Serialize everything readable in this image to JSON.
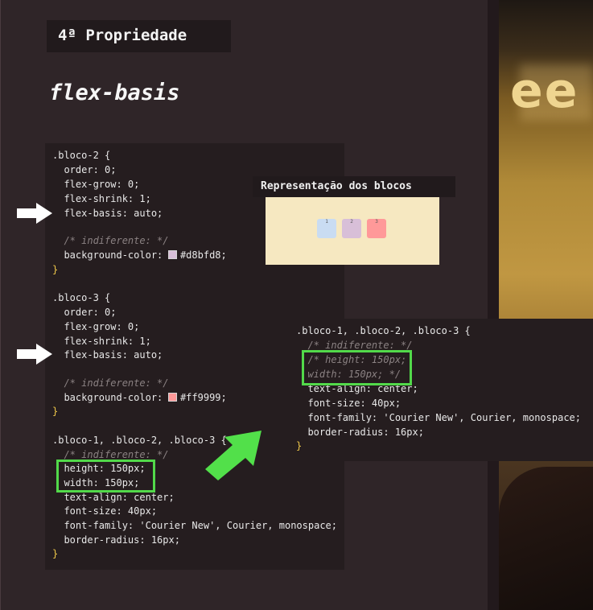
{
  "slide": {
    "title": "4ª Propriedade",
    "heading": "flex-basis"
  },
  "code_left": {
    "lines": [
      ".bloco-2 {",
      "  order: 0;",
      "  flex-grow: 0;",
      "  flex-shrink: 1;",
      "  flex-basis: auto;",
      "",
      "  /* indiferente: */",
      "  background-color: #d8bfd8;",
      "}",
      "",
      ".bloco-3 {",
      "  order: 0;",
      "  flex-grow: 0;",
      "  flex-shrink: 1;",
      "  flex-basis: auto;",
      "",
      "  /* indiferente: */",
      "  background-color: #ff9999;",
      "}",
      "",
      ".bloco-1, .bloco-2, .bloco-3 {",
      "  /* indiferente: */",
      "  height: 150px;",
      "  width: 150px;",
      "  text-align: center;",
      "  font-size: 40px;",
      "  font-family: 'Courier New', Courier, monospace;",
      "  border-radius: 16px;",
      "}"
    ]
  },
  "code_right": {
    "lines": [
      ".bloco-1, .bloco-2, .bloco-3 {",
      "  /* indiferente: */",
      "  /* height: 150px;",
      "  width: 150px; */",
      "  text-align: center;",
      "  font-size: 40px;",
      "  font-family: 'Courier New', Courier, monospace;",
      "  border-radius: 16px;",
      "}"
    ]
  },
  "representation": {
    "label": "Representação dos blocos",
    "blocks": [
      {
        "label": "1",
        "color": "#c9dcf2"
      },
      {
        "label": "2",
        "color": "#d8bfd8"
      },
      {
        "label": "3",
        "color": "#ff9999"
      }
    ]
  },
  "video": {
    "sign_text": "ee"
  },
  "colors": {
    "swatch_bloco2": "#d8bfd8",
    "swatch_bloco3": "#ff9999",
    "highlight": "#52d94a"
  }
}
